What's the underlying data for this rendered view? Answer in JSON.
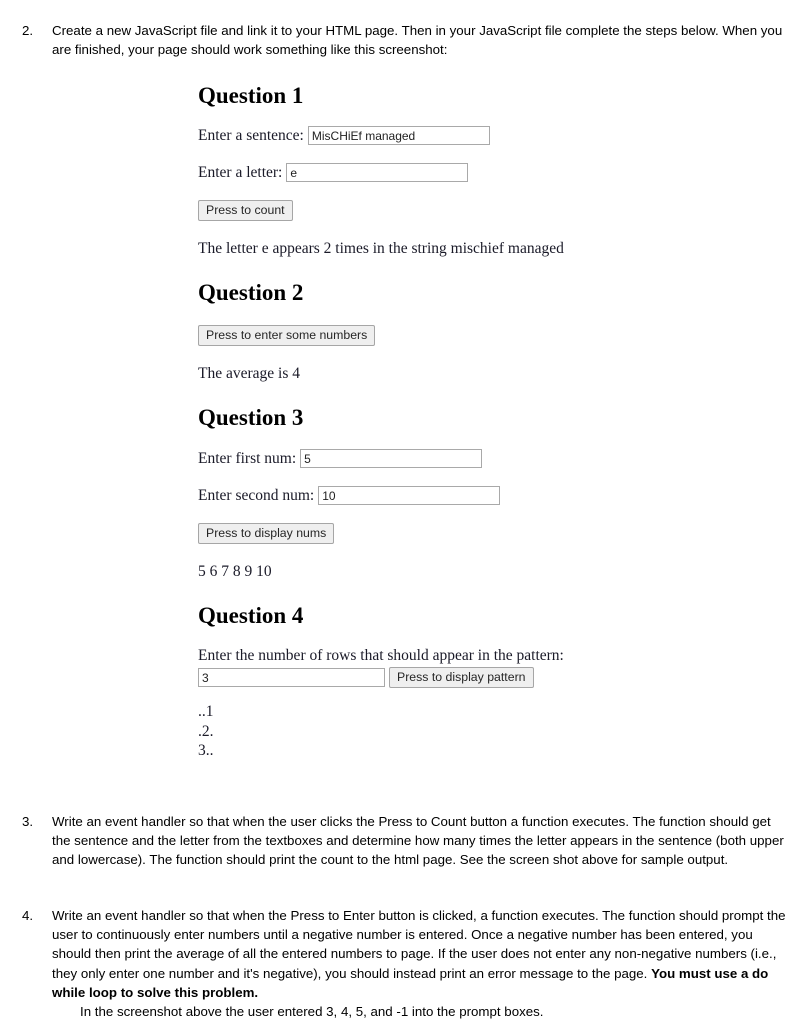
{
  "document": {
    "items": [
      {
        "number": "2.",
        "text": "Create a new JavaScript file and link it to your HTML page. Then in your JavaScript file complete the steps below. When you are finished, your page should work something like this screenshot:"
      },
      {
        "number": "3.",
        "text": "Write an event handler so that when the user clicks the Press to Count button a function executes. The function should get the sentence and the letter from the textboxes and determine how many times the letter appears in the sentence (both upper and lowercase). The function should print the count to the html page. See the screen shot above for sample output."
      },
      {
        "number": "4.",
        "text_part1": "Write an event handler so that when the Press to Enter button is clicked, a function executes. The function should prompt the user to continuously enter numbers until a negative number is entered. Once a negative number has been entered, you should then print the average of all the entered numbers to page. If the user does not enter any non-negative numbers (i.e., they only enter one number and it's negative), you should instead print an error message to the page. ",
        "text_bold": "You must use a do while loop to solve this problem.",
        "text_subline": "In the screenshot above the user entered 3, 4, 5, and -1 into the prompt boxes."
      }
    ]
  },
  "screenshot": {
    "question1": {
      "heading": "Question 1",
      "sentence_label": "Enter a sentence:",
      "sentence_value": "MisCHiEf managed",
      "letter_label": "Enter a letter:",
      "letter_value": "e",
      "button_label": "Press to count",
      "output": "The letter e appears 2 times in the string mischief managed"
    },
    "question2": {
      "heading": "Question 2",
      "button_label": "Press to enter some numbers",
      "output": "The average is 4"
    },
    "question3": {
      "heading": "Question 3",
      "first_label": "Enter first num:",
      "first_value": "5",
      "second_label": "Enter second num:",
      "second_value": "10",
      "button_label": "Press to display nums",
      "output": "5 6 7 8 9 10"
    },
    "question4": {
      "heading": "Question 4",
      "rows_label": "Enter the number of rows that should appear in the pattern:",
      "rows_value": "3",
      "button_label": "Press to display pattern",
      "pattern": [
        "..1",
        ".2.",
        "3.."
      ]
    }
  }
}
